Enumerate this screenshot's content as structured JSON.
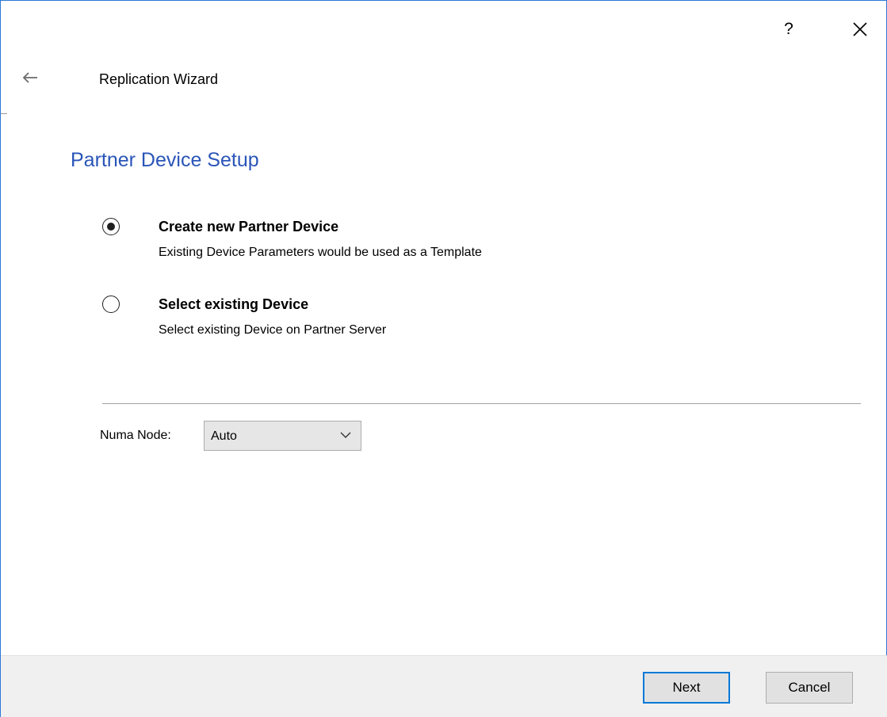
{
  "window": {
    "help_label": "?",
    "close_icon": "close-icon",
    "back_icon": "arrow-left-icon",
    "accent_color": "#2b79d8"
  },
  "wizard": {
    "title": "Replication Wizard",
    "page_heading": "Partner Device Setup",
    "heading_color": "#2a55b8"
  },
  "options": [
    {
      "title": "Create new Partner Device",
      "description": "Existing Device Parameters would be used as a Template",
      "selected": true
    },
    {
      "title": "Select existing Device",
      "description": "Select existing Device on Partner Server",
      "selected": false
    }
  ],
  "numa": {
    "label": "Numa Node:",
    "value": "Auto",
    "icon": "chevron-down-icon"
  },
  "footer": {
    "next_label": "Next",
    "cancel_label": "Cancel"
  }
}
